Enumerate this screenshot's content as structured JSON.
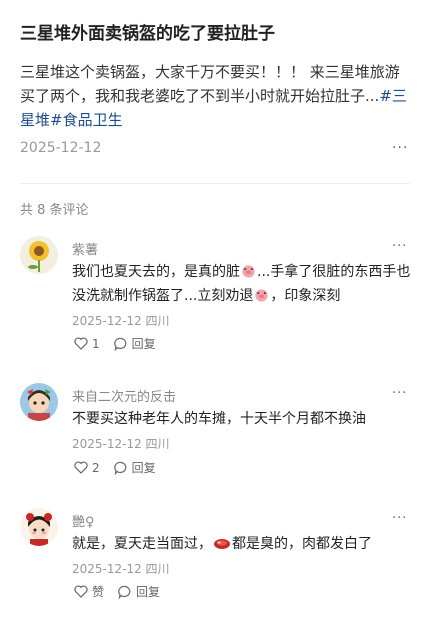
{
  "post": {
    "title": "三星堆外面卖锅盔的吃了要拉肚子",
    "body": "三星堆这个卖锅盔，大家千万不要买！！！ 来三星堆旅游买了两个，我和我老婆吃了不到半小时就开始拉肚子...",
    "tags": [
      "#三星堆",
      "#食品卫生"
    ],
    "date": "2025-12-12",
    "more": "···"
  },
  "comments_header": "共 8 条评论",
  "comments": [
    {
      "name": "紫薯",
      "text_a": "我们也夏天去的，是真的脏",
      "text_b": "...手拿了很脏的东西手也没洗就制作锅盔了...立刻劝退",
      "text_c": "，印象深刻",
      "meta": "2025-12-12 四川",
      "like": "1",
      "reply": "回复",
      "more": "···"
    },
    {
      "name": "来自二次元的反击",
      "text": "不要买这种老年人的车摊，十天半个月都不换油",
      "meta": "2025-12-12 四川",
      "like": "2",
      "reply": "回复",
      "more": "···"
    },
    {
      "name": "艷♀",
      "text_a": "就是，夏天走当面过，",
      "text_b": "都是臭的，肉都发白了",
      "meta": "2025-12-12 四川",
      "like": "赞",
      "reply": "回复",
      "more": "···"
    }
  ]
}
